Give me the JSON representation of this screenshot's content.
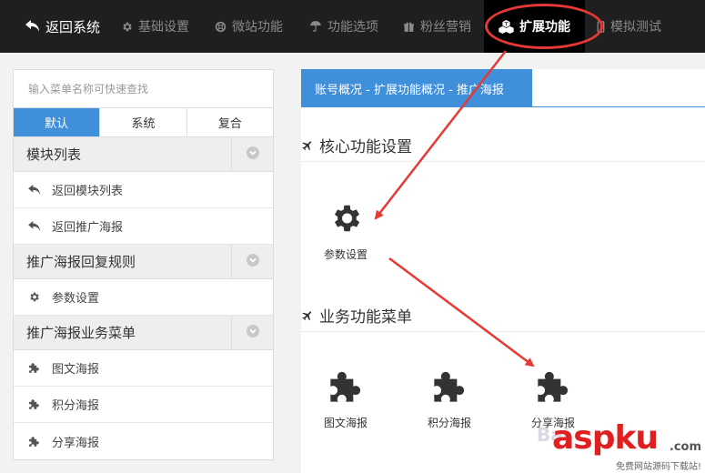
{
  "nav": {
    "back": "返回系统",
    "items": [
      "基础设置",
      "微站功能",
      "功能选项",
      "粉丝营销",
      "扩展功能",
      "模拟测试"
    ],
    "active_index": 4
  },
  "sidebar": {
    "search_placeholder": "输入菜单名称可快速查找",
    "tabs": [
      "默认",
      "系统",
      "复合"
    ],
    "active_tab": 0,
    "groups": [
      {
        "title": "模块列表",
        "items": [
          {
            "label": "返回模块列表",
            "icon": "reply-icon"
          },
          {
            "label": "返回推广海报",
            "icon": "reply-icon"
          }
        ]
      },
      {
        "title": "推广海报回复规则",
        "items": [
          {
            "label": "参数设置",
            "icon": "gear-icon"
          }
        ]
      },
      {
        "title": "推广海报业务菜单",
        "items": [
          {
            "label": "图文海报",
            "icon": "puzzle-icon"
          },
          {
            "label": "积分海报",
            "icon": "puzzle-icon"
          },
          {
            "label": "分享海报",
            "icon": "puzzle-icon"
          }
        ]
      }
    ]
  },
  "main": {
    "breadcrumb": "账号概况 - 扩展功能概况 - 推广海报",
    "core_title": "核心功能设置",
    "core_tiles": [
      {
        "label": "参数设置",
        "icon": "gear-icon"
      }
    ],
    "biz_title": "业务功能菜单",
    "biz_tiles": [
      {
        "label": "图文海报",
        "icon": "puzzle-icon"
      },
      {
        "label": "积分海报",
        "icon": "puzzle-icon"
      },
      {
        "label": "分享海报",
        "icon": "puzzle-icon"
      }
    ]
  },
  "watermark": {
    "brand": "aspku",
    "tld": ".com",
    "tagline": "免费网站源码下载站!"
  },
  "colors": {
    "accent": "#3f8fdb",
    "nav_bg": "#1f1f1f",
    "annotation_red": "#e53935"
  }
}
